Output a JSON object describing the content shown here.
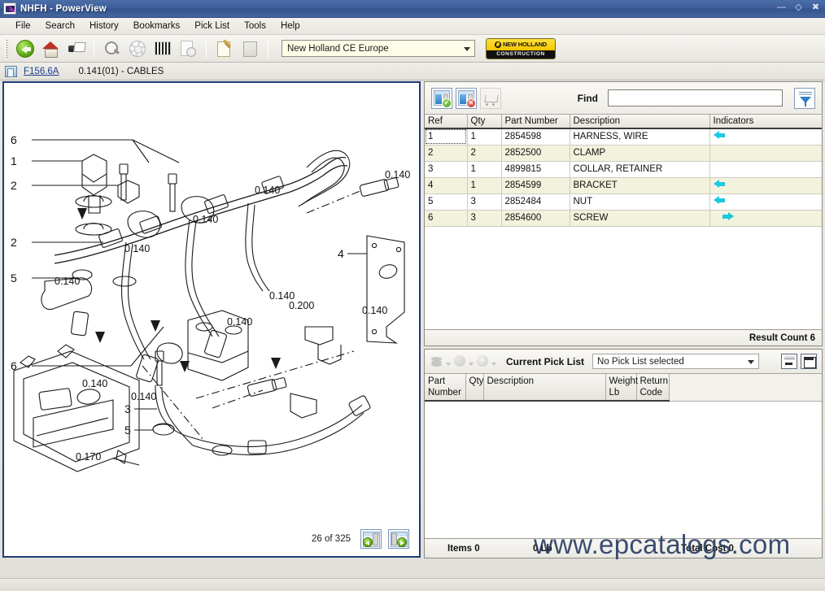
{
  "window": {
    "title": "NHFH - PowerView",
    "app_icon": "app-icon",
    "minimize": "—",
    "maximize": "◇",
    "close": "✖"
  },
  "menu": {
    "items": [
      "File",
      "Search",
      "History",
      "Bookmarks",
      "Pick List",
      "Tools",
      "Help"
    ]
  },
  "toolbar": {
    "buttons": [
      {
        "name": "back-button",
        "icon": "back-arrow-icon"
      },
      {
        "name": "home-button",
        "icon": "home-icon"
      },
      {
        "name": "print-button",
        "icon": "printer-icon"
      },
      {
        "name": "search-button",
        "icon": "magnifier-icon"
      },
      {
        "name": "settings-button",
        "icon": "gear-icon"
      },
      {
        "name": "barcode-button",
        "icon": "barcode-icon"
      },
      {
        "name": "document-search-button",
        "icon": "document-gear-icon"
      },
      {
        "name": "edit-note-button",
        "icon": "clipboard-pencil-icon"
      },
      {
        "name": "notes-button",
        "icon": "notepad-icon"
      }
    ],
    "catalog_combo": "New Holland CE Europe",
    "logo_top": "NEW HOLLAND",
    "logo_bottom": "CONSTRUCTION"
  },
  "breadcrumb": {
    "link": "F156.6A",
    "text": "0.141(01) - CABLES"
  },
  "illustration": {
    "page_indicator": "26 of 325",
    "ref_labels_left": [
      "6",
      "1",
      "2",
      "2",
      "5",
      "6"
    ],
    "callouts": [
      "0.140",
      "0.140",
      "0.140",
      "0.140",
      "0.140",
      "0.140",
      "0.140",
      "0.140",
      "0.140",
      "0.200",
      "0.140",
      "0.170"
    ],
    "part_refs_in_figure": [
      "4",
      "3",
      "5"
    ],
    "prev_button": "previous-page-icon",
    "next_button": "next-page-icon"
  },
  "results": {
    "toolbar": {
      "select_all": "select-all-icon",
      "deselect_all": "deselect-all-icon",
      "cart": "cart-icon",
      "find_label": "Find",
      "find_value": "",
      "find_placeholder": "",
      "filter": "filter-funnel-icon"
    },
    "columns": [
      "Ref",
      "Qty",
      "Part Number",
      "Description",
      "Indicators"
    ],
    "rows": [
      {
        "ref": "1",
        "qty": "1",
        "part": "2854598",
        "desc": "HARNESS, WIRE",
        "indicator": "left"
      },
      {
        "ref": "2",
        "qty": "2",
        "part": "2852500",
        "desc": "CLAMP",
        "indicator": ""
      },
      {
        "ref": "3",
        "qty": "1",
        "part": "4899815",
        "desc": "COLLAR, RETAINER",
        "indicator": ""
      },
      {
        "ref": "4",
        "qty": "1",
        "part": "2854599",
        "desc": "BRACKET",
        "indicator": "left"
      },
      {
        "ref": "5",
        "qty": "3",
        "part": "2852484",
        "desc": "NUT",
        "indicator": "left"
      },
      {
        "ref": "6",
        "qty": "3",
        "part": "2854600",
        "desc": "SCREW",
        "indicator": "right"
      }
    ],
    "footer": "Result Count 6"
  },
  "picklist": {
    "toolbar": {
      "stack_button": "picklist-stack-icon",
      "refresh_button": "picklist-refresh-icon",
      "add_button": "picklist-add-icon",
      "label": "Current Pick List",
      "selected": "No Pick List selected",
      "minimize": "minimize-panel-icon",
      "maximize": "maximize-panel-icon"
    },
    "columns": [
      "Part Number",
      "Qty",
      "Description",
      "Weight Lb",
      "Return Code"
    ],
    "rows": [],
    "footer": {
      "items": "Items 0",
      "weight": "0 Lb",
      "cost": "Total Cost 0"
    }
  },
  "watermark": "www.epcatalogs.com",
  "colors": {
    "titlebar": "#3f5f9b",
    "accent_link": "#1c3f94",
    "indicator_arrow": "#1fc8dd",
    "alt_row": "#f2f2dd",
    "logo_yellow": "#f5c400",
    "panel_border": "#1f3c78"
  }
}
